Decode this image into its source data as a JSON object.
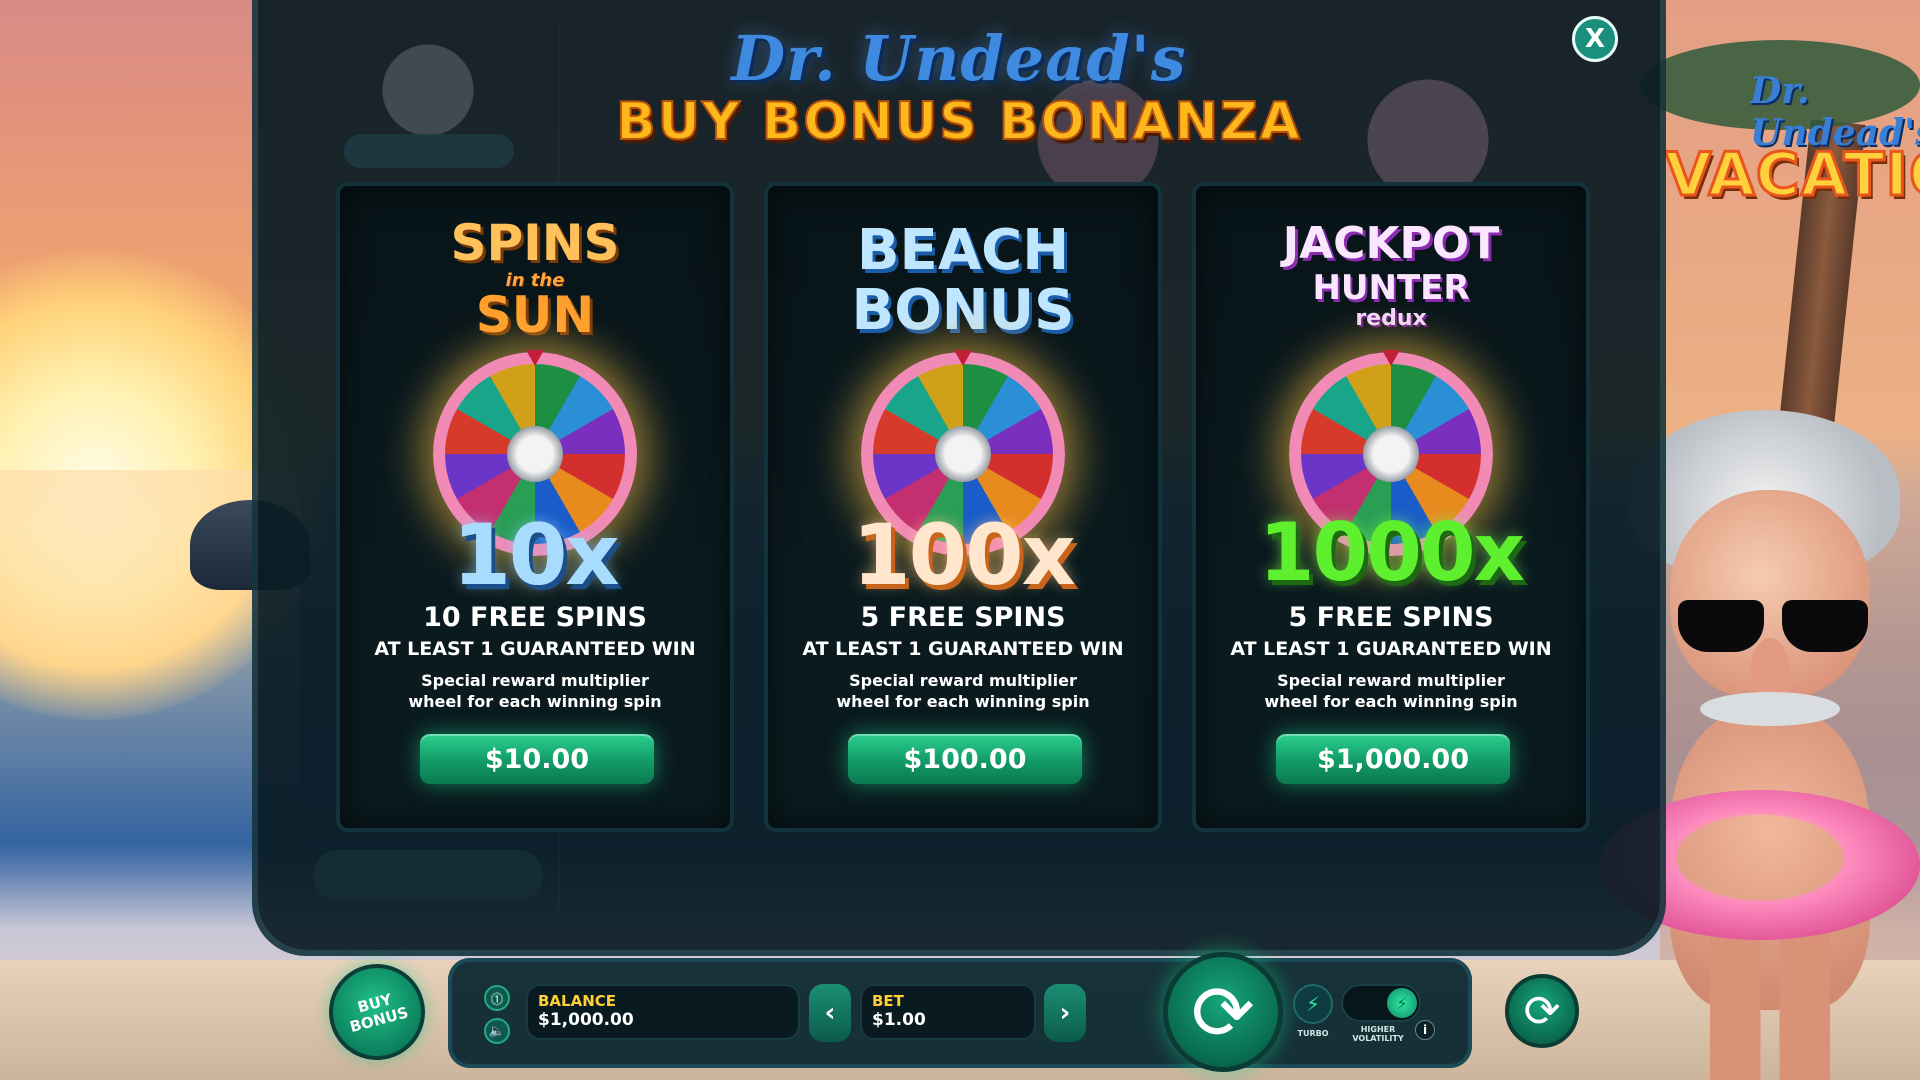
{
  "window": {
    "side_logo_script": "Dr. Undead's",
    "side_logo_big": "VACATIO"
  },
  "modal": {
    "title_script": "Dr. Undead's",
    "title_main": "BUY BONUS BONANZA",
    "close_label": "X",
    "cards": [
      {
        "name_line1": "SPINS",
        "name_line2": "in the",
        "name_line3": "SUN",
        "multiplier": "10x",
        "spins": "10 FREE SPINS",
        "guarantee": "AT LEAST 1 GUARANTEED WIN",
        "desc_line1": "Special reward multiplier",
        "desc_line2": "wheel for each winning spin",
        "price": "$10.00",
        "accent": "#ffb74a",
        "multiplier_color": "#9fd8ff"
      },
      {
        "name_line1": "BEACH",
        "name_line2": "BONUS",
        "multiplier": "100x",
        "spins": "5 FREE SPINS",
        "guarantee": "AT LEAST 1 GUARANTEED WIN",
        "desc_line1": "Special reward multiplier",
        "desc_line2": "wheel for each winning spin",
        "price": "$100.00",
        "accent": "#8fd3ff",
        "multiplier_color": "#ffe4c8"
      },
      {
        "name_line1": "JACKPOT",
        "name_line2": "HUNTER",
        "name_line3": "redux",
        "multiplier": "1000x",
        "spins": "5 FREE SPINS",
        "guarantee": "AT LEAST 1 GUARANTEED WIN",
        "desc_line1": "Special reward multiplier",
        "desc_line2": "wheel for each winning spin",
        "price": "$1,000.00",
        "accent": "#f7d9ff",
        "multiplier_color": "#4fe32a"
      }
    ]
  },
  "controls": {
    "buy_bonus_line1": "BUY",
    "buy_bonus_line2": "BONUS",
    "balance_label": "BALANCE",
    "balance_value": "$1,000.00",
    "bet_label": "BET",
    "bet_value": "$1.00",
    "bet_decrease": "‹",
    "bet_increase": "›",
    "turbo_label": "TURBO",
    "volatility_line1": "HIGHER",
    "volatility_line2": "VOLATILITY",
    "info_label": "i",
    "spin_icon": "⟳",
    "autoplay_icon": "⟳",
    "settings_icon": "⓵",
    "sound_icon": "🔈"
  },
  "colors": {
    "brand_green": "#129a67",
    "title_gold": "#ffb81c",
    "label_yellow": "#ffcf35"
  }
}
